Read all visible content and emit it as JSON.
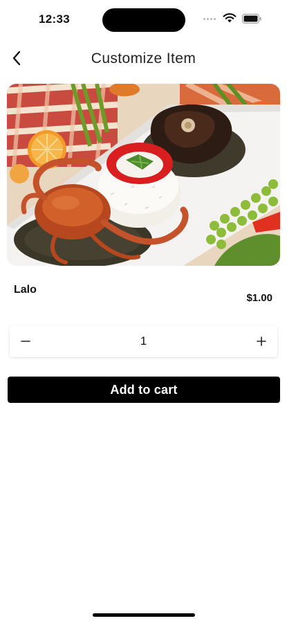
{
  "status_bar": {
    "time": "12:33"
  },
  "nav": {
    "title": "Customize Item",
    "back_icon": "chevron-left-icon"
  },
  "item": {
    "image_subject": "food-photo-crab-rice-pepper-callaloo-plate",
    "name": "Lalo",
    "price": "$1.00"
  },
  "quantity": {
    "value": "1",
    "minus_icon": "minus-icon",
    "plus_icon": "plus-icon"
  },
  "actions": {
    "add_to_cart_label": "Add to cart"
  },
  "colors": {
    "primary_button": "#000000",
    "button_text": "#ffffff",
    "background": "#ffffff"
  }
}
